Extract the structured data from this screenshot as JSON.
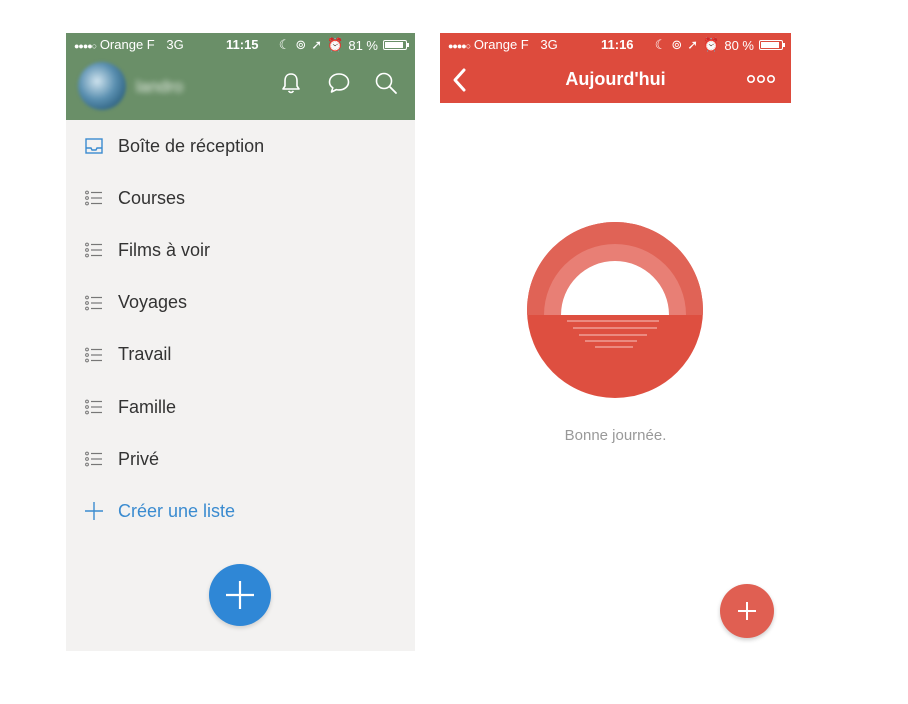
{
  "left": {
    "status_bar": {
      "carrier": "Orange F",
      "network": "3G",
      "time": "11:15",
      "battery": "81 %",
      "battery_level": 0.81
    },
    "header": {
      "user_name": "landro"
    },
    "menu": [
      {
        "label": "Boîte de réception",
        "icon": "inbox-icon"
      },
      {
        "label": "Courses",
        "icon": "list-icon"
      },
      {
        "label": "Films à voir",
        "icon": "list-icon"
      },
      {
        "label": "Voyages",
        "icon": "list-icon"
      },
      {
        "label": "Travail",
        "icon": "list-icon"
      },
      {
        "label": "Famille",
        "icon": "list-icon"
      },
      {
        "label": "Privé",
        "icon": "list-icon"
      }
    ],
    "create_list": {
      "label": "Créer une liste",
      "icon": "plus-icon"
    },
    "colors": {
      "header": "#6a8f68",
      "accent": "#2f87d6",
      "background": "#f3f2f1"
    }
  },
  "right": {
    "status_bar": {
      "carrier": "Orange F",
      "network": "3G",
      "time": "11:16",
      "battery": "80 %",
      "battery_level": 0.8
    },
    "header": {
      "title": "Aujourd'hui"
    },
    "empty_state": {
      "message": "Bonne journée."
    },
    "colors": {
      "header": "#dd4b3d",
      "accent": "#e05f52"
    }
  }
}
